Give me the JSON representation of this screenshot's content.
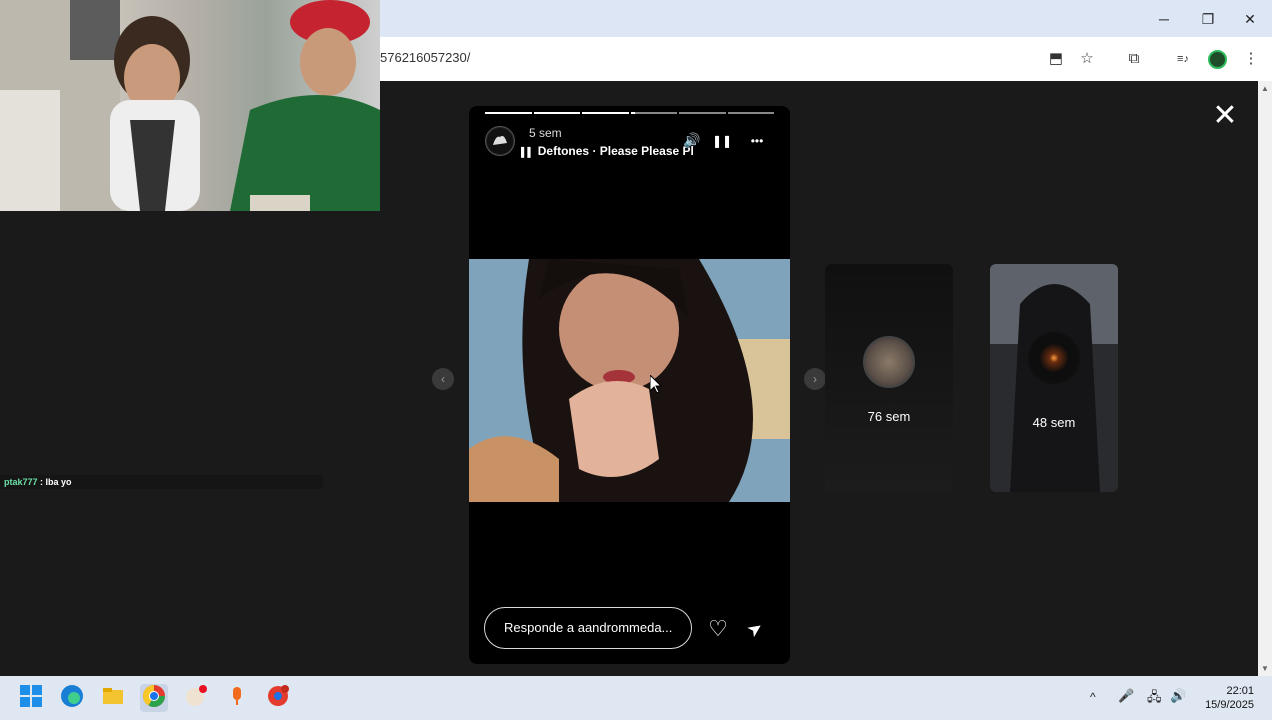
{
  "browser": {
    "url_fragment": "576216057230/",
    "window_buttons": {
      "minimize": "─",
      "restore": "❐",
      "close": "✕"
    },
    "toolbar_icons": {
      "install": "⬒",
      "star": "☆",
      "extensions": "⧉",
      "media": "≡♪",
      "menu": "⋮"
    }
  },
  "chat": {
    "username": "ptak777",
    "separator": " : ",
    "message": "Iba yo"
  },
  "story": {
    "progress_segments": [
      1,
      1,
      1,
      0.1,
      0,
      0
    ],
    "time": "5 sem",
    "music": "Deftones · Please Please Pl",
    "icons": {
      "mute": "🔊",
      "pause": "❚❚",
      "more": "•••"
    },
    "reply_placeholder": "Responde a aandrommeda...",
    "like_icon": "♡",
    "send_icon": "➤"
  },
  "next_stories": [
    {
      "label": "76 sem"
    },
    {
      "label": "48 sem"
    }
  ],
  "nav": {
    "prev": "‹",
    "next": "›"
  },
  "close_icon": "✕",
  "taskbar": {
    "time": "22:01",
    "date": "15/9/2025",
    "tray_chevron": "^",
    "mic": "🎤",
    "network": "🖧",
    "volume": "🔊"
  },
  "colors": {
    "chat_username": "#6de0a7",
    "page_bg": "#1a1a1a",
    "taskbar_bg": "#dfe7f3",
    "titlebar_bg": "#dce6f5"
  }
}
